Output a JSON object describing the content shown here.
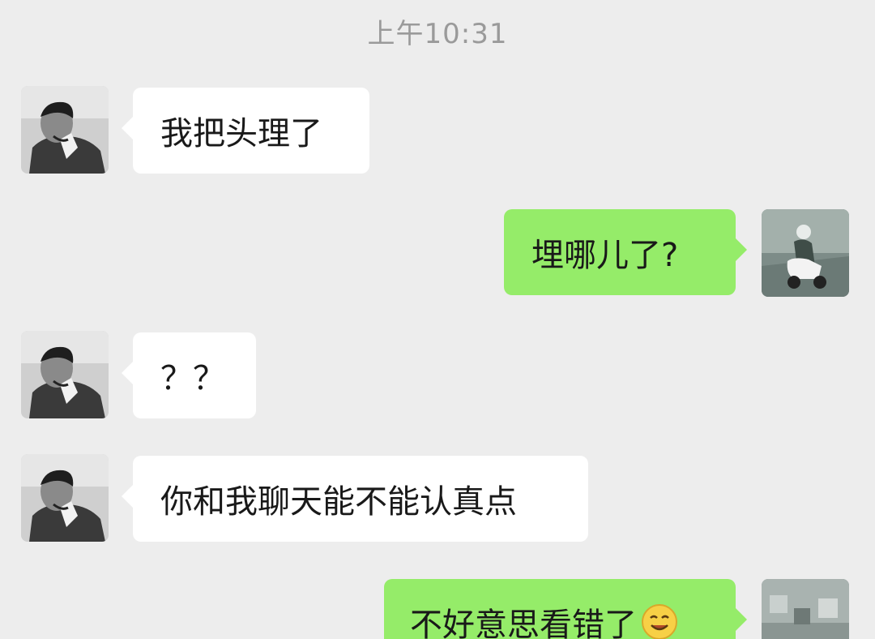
{
  "timestamp": "上午10:31",
  "messages": [
    {
      "side": "in",
      "text": "我把头理了",
      "avatar_icon": "male-avatar-icon"
    },
    {
      "side": "out",
      "text": "埋哪儿了?",
      "avatar_icon": "scooter-rider-avatar-icon"
    },
    {
      "side": "in",
      "text": "？？",
      "avatar_icon": "male-avatar-icon"
    },
    {
      "side": "in",
      "text": "你和我聊天能不能认真点",
      "avatar_icon": "male-avatar-icon"
    },
    {
      "side": "out",
      "text": "不好意思看错了",
      "emoji": "smile-emoji-icon",
      "avatar_icon": "scooter-rider-avatar-icon"
    }
  ],
  "colors": {
    "background": "#ededed",
    "incoming_bubble": "#ffffff",
    "outgoing_bubble": "#95ec69",
    "timestamp_text": "#9a9a9a"
  }
}
